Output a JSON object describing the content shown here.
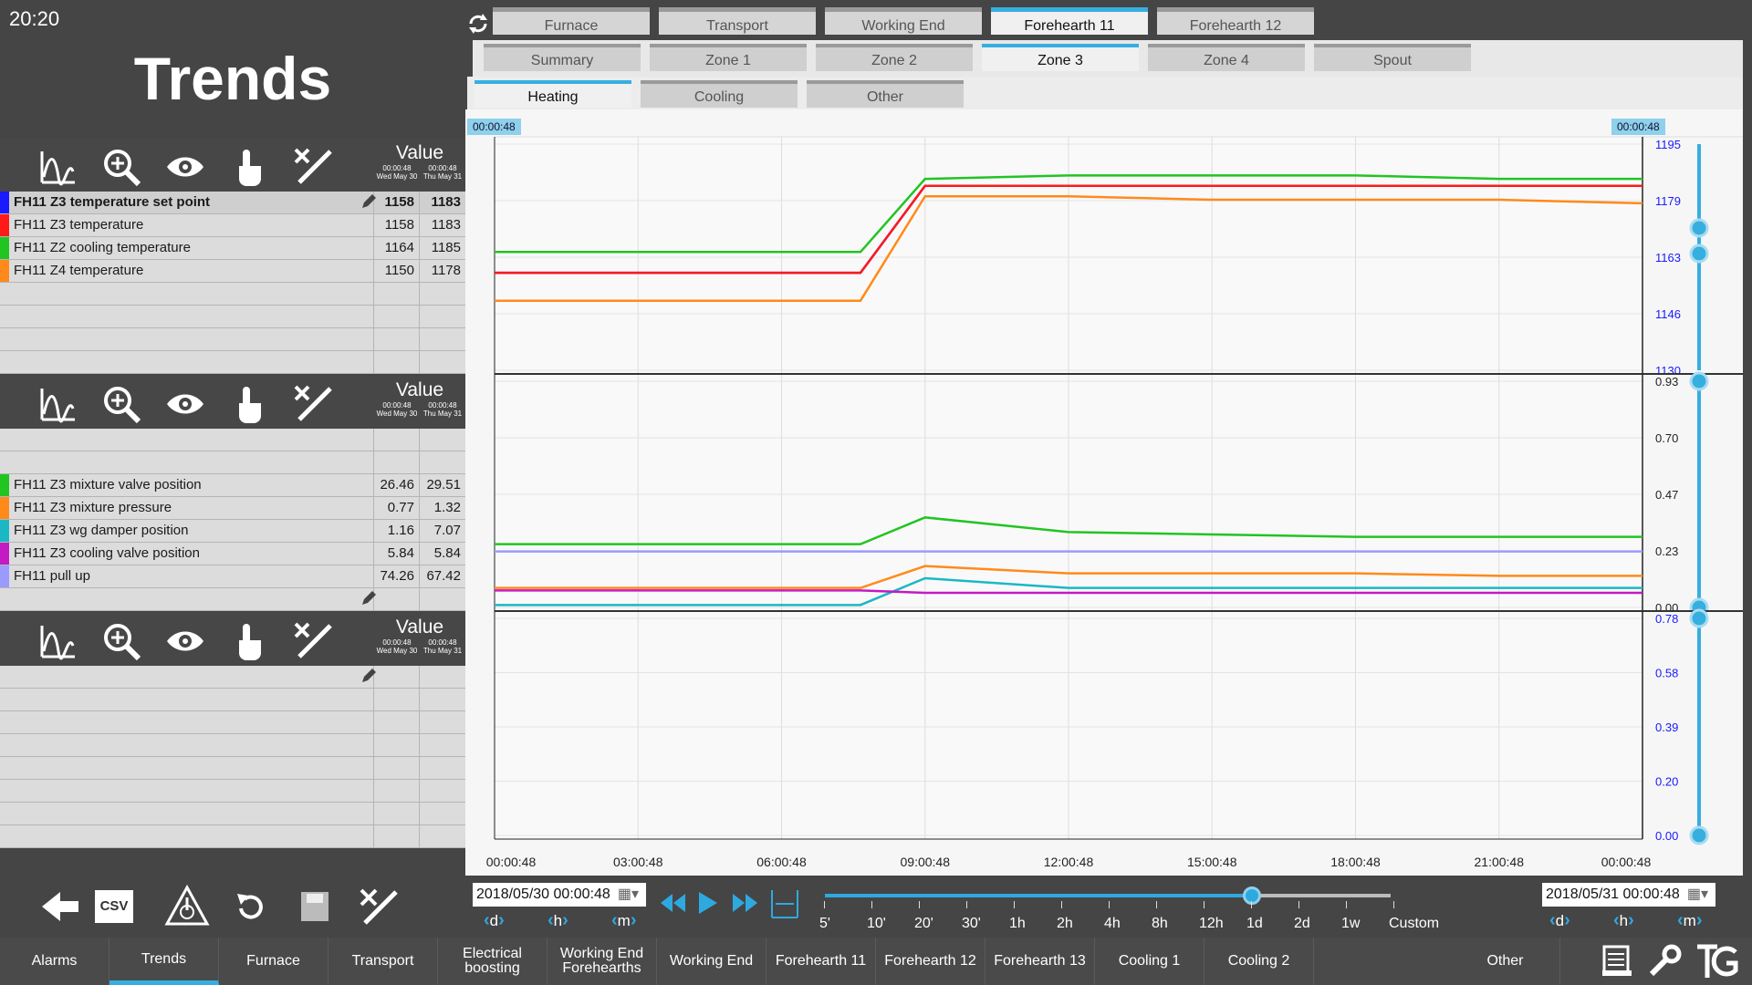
{
  "clock": "20:20",
  "page_title": "Trends",
  "tabs_top": [
    {
      "label": "Furnace",
      "active": false
    },
    {
      "label": "Transport",
      "active": false
    },
    {
      "label": "Working End",
      "active": false
    },
    {
      "label": "Forehearth 11",
      "active": true
    },
    {
      "label": "Forehearth 12",
      "active": false
    }
  ],
  "tabs_zone": [
    {
      "label": "Summary",
      "active": false
    },
    {
      "label": "Zone 1",
      "active": false
    },
    {
      "label": "Zone 2",
      "active": false
    },
    {
      "label": "Zone 3",
      "active": true
    },
    {
      "label": "Zone 4",
      "active": false
    },
    {
      "label": "Spout",
      "active": false
    }
  ],
  "tabs_sub": [
    {
      "label": "Heating",
      "active": true
    },
    {
      "label": "Cooling",
      "active": false
    },
    {
      "label": "Other",
      "active": false
    }
  ],
  "value_header": {
    "label": "Value",
    "t1": "00:00:48",
    "t2": "00:00:48",
    "d1": "Wed May 30",
    "d2": "Thu May 31"
  },
  "panel1_rows": [
    {
      "name": "FH11 Z3 temperature set point",
      "v1": "1158",
      "v2": "1183",
      "color": "#1a1aff",
      "selected": true
    },
    {
      "name": "FH11 Z3 temperature",
      "v1": "1158",
      "v2": "1183",
      "color": "#ff1a1a",
      "selected": false
    },
    {
      "name": "FH11 Z2 cooling temperature",
      "v1": "1164",
      "v2": "1185",
      "color": "#22c422",
      "selected": false
    },
    {
      "name": "FH11 Z4 temperature",
      "v1": "1150",
      "v2": "1178",
      "color": "#ff8a1a",
      "selected": false
    }
  ],
  "panel2_rows": [
    {
      "name": "FH11 Z3 mixture valve position",
      "v1": "26.46",
      "v2": "29.51",
      "color": "#22c422"
    },
    {
      "name": "FH11 Z3 mixture pressure",
      "v1": "0.77",
      "v2": "1.32",
      "color": "#ff8a1a"
    },
    {
      "name": "FH11 Z3 wg damper position",
      "v1": "1.16",
      "v2": "7.07",
      "color": "#1ab8c4"
    },
    {
      "name": "FH11 Z3 cooling valve position",
      "v1": "5.84",
      "v2": "5.84",
      "color": "#c41ac4"
    },
    {
      "name": "FH11 pull up",
      "v1": "74.26",
      "v2": "67.42",
      "color": "#9a9aff"
    }
  ],
  "cursor_left": "00:00:48",
  "cursor_right": "00:00:48",
  "chart_data": [
    {
      "type": "line",
      "x": [
        "00:00:48",
        "03:00:48",
        "06:00:48",
        "09:00:48",
        "12:00:48",
        "15:00:48",
        "18:00:48",
        "21:00:48",
        "00:00:48"
      ],
      "y_ticks": [
        "1195",
        "1179",
        "1163",
        "1146",
        "1130"
      ],
      "ylim": [
        1130,
        1195
      ],
      "series": [
        {
          "name": "FH11 Z3 temperature set point",
          "color": "#1a1aff",
          "values": [
            1158,
            1158,
            1158,
            1183,
            1183,
            1183,
            1183,
            1183,
            1183
          ]
        },
        {
          "name": "FH11 Z3 temperature",
          "color": "#ff1a1a",
          "values": [
            1158,
            1158,
            1158,
            1183,
            1183,
            1183,
            1183,
            1183,
            1183
          ]
        },
        {
          "name": "FH11 Z2 cooling temperature",
          "color": "#22c422",
          "values": [
            1164,
            1164,
            1164,
            1185,
            1186,
            1186,
            1186,
            1185,
            1185
          ]
        },
        {
          "name": "FH11 Z4 temperature",
          "color": "#ff8a1a",
          "values": [
            1150,
            1150,
            1150,
            1180,
            1180,
            1179,
            1179,
            1179,
            1178
          ]
        }
      ]
    },
    {
      "type": "line",
      "x": [
        "00:00:48",
        "03:00:48",
        "06:00:48",
        "09:00:48",
        "12:00:48",
        "15:00:48",
        "18:00:48",
        "21:00:48",
        "00:00:48"
      ],
      "y_ticks": [
        "0.93",
        "0.70",
        "0.47",
        "0.23",
        "0.00"
      ],
      "ylim": [
        0,
        0.93
      ],
      "series": [
        {
          "name": "FH11 Z3 mixture valve position",
          "color": "#22c422",
          "values": [
            0.26,
            0.26,
            0.26,
            0.37,
            0.31,
            0.3,
            0.29,
            0.29,
            0.29
          ]
        },
        {
          "name": "FH11 Z3 mixture pressure",
          "color": "#ff8a1a",
          "values": [
            0.08,
            0.08,
            0.08,
            0.17,
            0.14,
            0.14,
            0.14,
            0.13,
            0.13
          ]
        },
        {
          "name": "FH11 Z3 wg damper position",
          "color": "#1ab8c4",
          "values": [
            0.01,
            0.01,
            0.01,
            0.12,
            0.08,
            0.08,
            0.08,
            0.08,
            0.08
          ]
        },
        {
          "name": "FH11 Z3 cooling valve position",
          "color": "#c41ac4",
          "values": [
            0.07,
            0.07,
            0.07,
            0.06,
            0.06,
            0.06,
            0.06,
            0.06,
            0.06
          ]
        },
        {
          "name": "FH11 pull up",
          "color": "#9a9aff",
          "values": [
            0.23,
            0.23,
            0.23,
            0.23,
            0.23,
            0.23,
            0.23,
            0.23,
            0.23
          ]
        }
      ]
    },
    {
      "type": "line",
      "x": [
        "00:00:48",
        "03:00:48",
        "06:00:48",
        "09:00:48",
        "12:00:48",
        "15:00:48",
        "18:00:48",
        "21:00:48",
        "00:00:48"
      ],
      "y_ticks": [
        "0.78",
        "0.58",
        "0.39",
        "0.20",
        "0.00"
      ],
      "ylim": [
        0,
        0.78
      ],
      "series": []
    }
  ],
  "x_labels": [
    "00:00:48",
    "03:00:48",
    "06:00:48",
    "09:00:48",
    "12:00:48",
    "15:00:48",
    "18:00:48",
    "21:00:48",
    "00:00:48"
  ],
  "date_start": "2018/05/30 00:00:48",
  "date_end": "2018/05/31 00:00:48",
  "nav_units": [
    "d",
    "h",
    "m"
  ],
  "scale_labels": [
    "5'",
    "10'",
    "20'",
    "30'",
    "1h",
    "2h",
    "4h",
    "8h",
    "12h",
    "1d",
    "2d",
    "1w",
    "Custom"
  ],
  "scale_selected": "1d",
  "csv_label": "CSV",
  "bottom_nav": [
    {
      "label": "Alarms",
      "active": false
    },
    {
      "label": "Trends",
      "active": true
    },
    {
      "label": "Furnace",
      "active": false
    },
    {
      "label": "Transport",
      "active": false
    },
    {
      "label": "Electrical boosting",
      "active": false
    },
    {
      "label": "Working End Forehearths",
      "active": false
    },
    {
      "label": "Working End",
      "active": false
    },
    {
      "label": "Forehearth 11",
      "active": false
    },
    {
      "label": "Forehearth 12",
      "active": false
    },
    {
      "label": "Forehearth 13",
      "active": false
    },
    {
      "label": "Cooling 1",
      "active": false
    },
    {
      "label": "Cooling 2",
      "active": false
    },
    {
      "label": "Other",
      "active": false
    }
  ],
  "accent": "#37aee0"
}
